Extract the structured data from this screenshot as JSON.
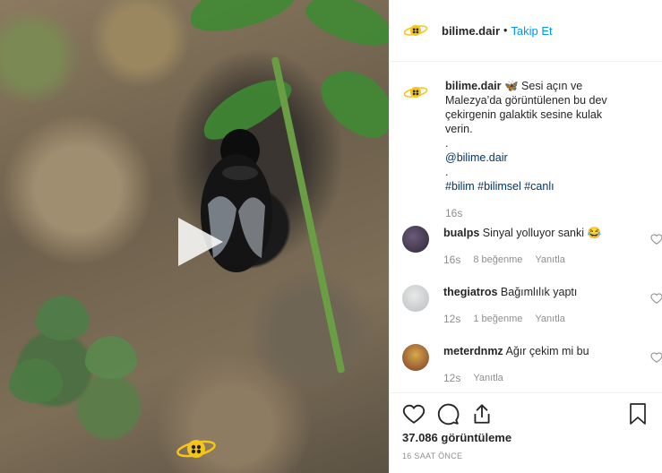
{
  "post": {
    "username": "bilime.dair",
    "separator": "•",
    "follow_label": "Takip Et"
  },
  "caption": {
    "username": "bilime.dair",
    "text": "🦋 Sesi açın ve Malezya’da görüntülenen bu dev çekirgenin galaktik sesine kulak verin.",
    "dot1": ".",
    "mention": "@bilime.dair",
    "dot2": ".",
    "hashtags": "#bilim #bilimsel #canlı",
    "time": "16s"
  },
  "comments": [
    {
      "username": "bualps",
      "text": "Sinyal yolluyor sanki 😂",
      "time": "16s",
      "likes": "8 beğenme",
      "reply": "Yanıtla"
    },
    {
      "username": "thegiatros",
      "text": "Bağımlılık yaptı",
      "time": "12s",
      "likes": "1 beğenme",
      "reply": "Yanıtla"
    },
    {
      "username": "meterdnmz",
      "text": "Ağır çekim mi bu",
      "time": "12s",
      "likes": "",
      "reply": "Yanıtla"
    }
  ],
  "stats": {
    "views": "37.086 görüntüleme",
    "posted_ago": "16 SAAT ÖNCE"
  },
  "icons": {
    "play": "play-icon",
    "like": "heart-icon",
    "comment": "comment-icon",
    "share": "share-icon",
    "save": "bookmark-icon"
  },
  "colors": {
    "link": "#0095f6",
    "hashtag": "#00376b",
    "muted": "#8e8e8e",
    "logo_yellow": "#f5c518"
  }
}
